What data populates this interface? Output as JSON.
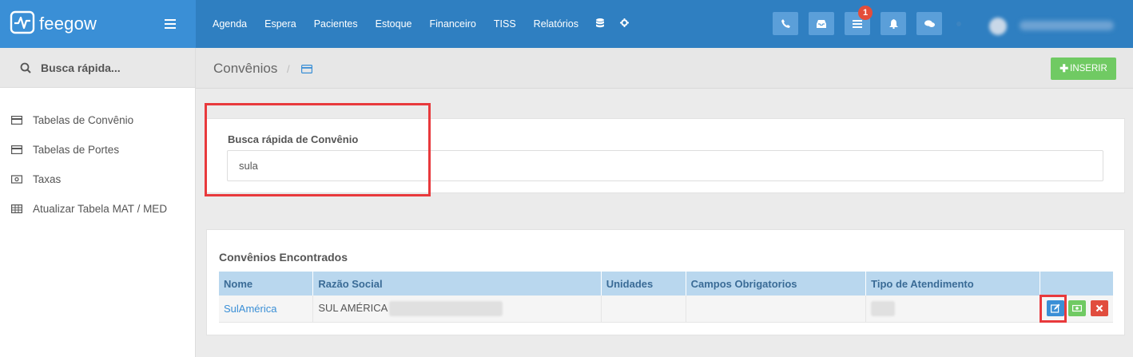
{
  "brand": {
    "name": "feegow"
  },
  "nav": {
    "items": [
      "Agenda",
      "Espera",
      "Pacientes",
      "Estoque",
      "Financeiro",
      "TISS",
      "Relatórios"
    ],
    "extra_icons": [
      "database-icon",
      "gear-icon"
    ]
  },
  "header_icons": [
    {
      "name": "phone-icon"
    },
    {
      "name": "inbox-icon"
    },
    {
      "name": "list-icon",
      "badge": "1"
    },
    {
      "name": "bell-icon"
    },
    {
      "name": "chat-icon"
    }
  ],
  "sidebar": {
    "search_label": "Busca rápida...",
    "items": [
      {
        "label": "Tabelas de Convênio",
        "icon": "card-icon"
      },
      {
        "label": "Tabelas de Portes",
        "icon": "card-icon"
      },
      {
        "label": "Taxas",
        "icon": "money-icon"
      },
      {
        "label": "Atualizar Tabela MAT / MED",
        "icon": "table-icon"
      }
    ]
  },
  "page": {
    "title": "Convênios",
    "breadcrumb_sep": "/",
    "insert_label": "INSERIR"
  },
  "search": {
    "label": "Busca rápida de Convênio",
    "value": "sula"
  },
  "results": {
    "title": "Convênios Encontrados",
    "columns": [
      "Nome",
      "Razão Social",
      "Unidades",
      "Campos Obrigatorios",
      "Tipo de Atendimento",
      ""
    ],
    "rows": [
      {
        "nome": "SulAmérica",
        "razao_social": "SUL AMÉRICA",
        "unidades": "",
        "campos": "",
        "tipo": ""
      }
    ]
  },
  "colors": {
    "topbar": "#2f7fc1",
    "brand_bg": "#3a8fd6",
    "insert_green": "#70ca63",
    "highlight_red": "#e8393c",
    "table_header": "#b9d7ee"
  }
}
